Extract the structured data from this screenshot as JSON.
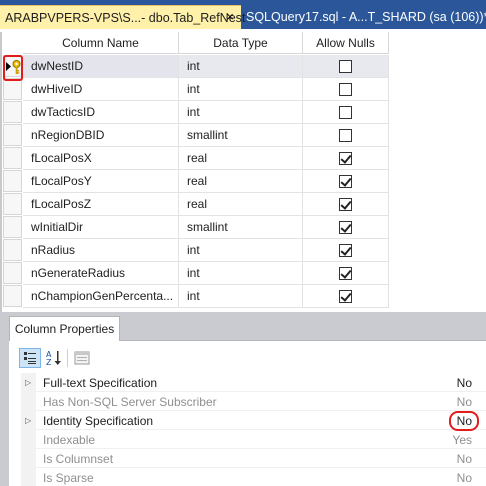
{
  "tabs": {
    "active": {
      "title": "ARABPVPERS-VPS\\S...- dbo.Tab_RefNest",
      "close": "×"
    },
    "inactive": {
      "title": "SQLQuery17.sql - A...T_SHARD (sa (106))*"
    }
  },
  "grid": {
    "headers": [
      "Column Name",
      "Data Type",
      "Allow Nulls"
    ],
    "rows": [
      {
        "name": "dwNestID",
        "type": "int",
        "allow_nulls": false,
        "current": true,
        "primary_key": true
      },
      {
        "name": "dwHiveID",
        "type": "int",
        "allow_nulls": false
      },
      {
        "name": "dwTacticsID",
        "type": "int",
        "allow_nulls": false
      },
      {
        "name": "nRegionDBID",
        "type": "smallint",
        "allow_nulls": false
      },
      {
        "name": "fLocalPosX",
        "type": "real",
        "allow_nulls": true
      },
      {
        "name": "fLocalPosY",
        "type": "real",
        "allow_nulls": true
      },
      {
        "name": "fLocalPosZ",
        "type": "real",
        "allow_nulls": true
      },
      {
        "name": "wInitialDir",
        "type": "smallint",
        "allow_nulls": true
      },
      {
        "name": "nRadius",
        "type": "int",
        "allow_nulls": true
      },
      {
        "name": "nGenerateRadius",
        "type": "int",
        "allow_nulls": true
      },
      {
        "name": "nChampionGenPercenta...",
        "type": "int",
        "allow_nulls": true
      }
    ]
  },
  "properties": {
    "tab_label": "Column Properties",
    "toolbar": [
      "categorized-icon",
      "alphabetical-icon",
      "property-pages-icon"
    ],
    "items": [
      {
        "name": "Full-text Specification",
        "value": "No",
        "expandable": true,
        "disabled": false
      },
      {
        "name": "Has Non-SQL Server Subscriber",
        "value": "No",
        "expandable": false,
        "disabled": true
      },
      {
        "name": "Identity Specification",
        "value": "No",
        "expandable": true,
        "disabled": false,
        "highlighted": true
      },
      {
        "name": "Indexable",
        "value": "Yes",
        "expandable": false,
        "disabled": true
      },
      {
        "name": "Is Columnset",
        "value": "No",
        "expandable": false,
        "disabled": true
      },
      {
        "name": "Is Sparse",
        "value": "No",
        "expandable": false,
        "disabled": true
      }
    ]
  },
  "colors": {
    "tabstrip": "#2b579a",
    "active_tab": "#fff1a9",
    "annotation": "#e21c1c"
  }
}
